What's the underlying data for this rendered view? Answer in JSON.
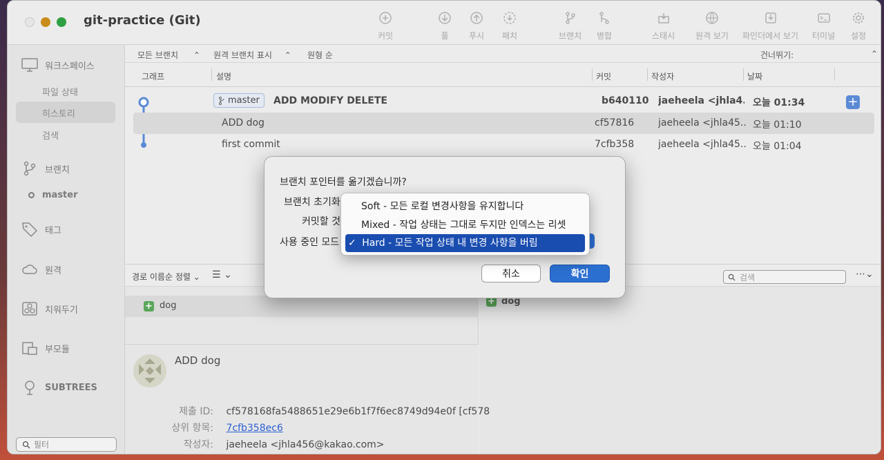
{
  "window": {
    "title": "git-practice (Git)"
  },
  "toolbar": {
    "commit": "커밋",
    "pull": "풀",
    "push": "푸시",
    "fetch": "패치",
    "branch": "브랜치",
    "merge": "병합",
    "stash": "스태시",
    "remote": "원격 보기",
    "finder": "파인더에서 보기",
    "terminal": "터미널",
    "settings": "설정"
  },
  "sidebar": {
    "workspace": "워크스페이스",
    "file_status": "파일 상태",
    "history": "히스토리",
    "search": "검색",
    "branches": "브랜치",
    "master": "master",
    "tags": "태그",
    "remotes": "원격",
    "stashes": "치워두기",
    "submodules": "부모듈",
    "subtrees": "SUBTREES",
    "filter_placeholder": "필터"
  },
  "filterbar": {
    "branches": "모든 브랜치",
    "remote": "원격 브랜치 표시",
    "order": "원형 순",
    "skip": "건너뛰기:"
  },
  "columns": {
    "graph": "그래프",
    "desc": "설명",
    "commit": "커밋",
    "author": "작성자",
    "date": "날짜"
  },
  "commits": [
    {
      "branch": "master",
      "desc": "ADD MODIFY DELETE",
      "hash": "b640110",
      "author": "jaeheela <jhla4...",
      "date": "오늘 01:34"
    },
    {
      "desc": "ADD dog",
      "hash": "cf57816",
      "author": "jaeheela <jhla45...",
      "date": "오늘 01:10"
    },
    {
      "desc": "first commit",
      "hash": "7cfb358",
      "author": "jaeheela <jhla45...",
      "date": "오늘 01:04"
    }
  ],
  "lower": {
    "sort": "경로 이름순 정렬",
    "search_placeholder": "검색",
    "file": "dog",
    "right_file": "dog"
  },
  "detail": {
    "message": "ADD dog",
    "commit_label": "제출 ID:",
    "commit_value": "cf578168fa5488651e29e6b1f7f6ec8749d94e0f [cf578",
    "parent_label": "상위 항목:",
    "parent_value": "7cfb358ec6",
    "author_label": "작성자:",
    "author_value": "jaeheela <jhla456@kakao.com>"
  },
  "dialog": {
    "question": "브랜치 포인터를 옮기겠습니까?",
    "reset_label": "브랜치 초기화",
    "commit_label": "커밋할 것",
    "mode_label": "사용 중인 모드",
    "cancel": "취소",
    "ok": "확인"
  },
  "popup": {
    "options": [
      "Soft - 모든 로컬 변경사항을 유지합니다",
      "Mixed - 작업 상태는 그대로 두지만 인덱스는 리셋",
      "Hard - 모든 작업 상태 내 변경 사항을 버림"
    ],
    "check": "✓"
  },
  "colors": {
    "accent": "#2b6fd1",
    "graph": "#5b8ad6",
    "selected_option": "#1a4db0"
  }
}
